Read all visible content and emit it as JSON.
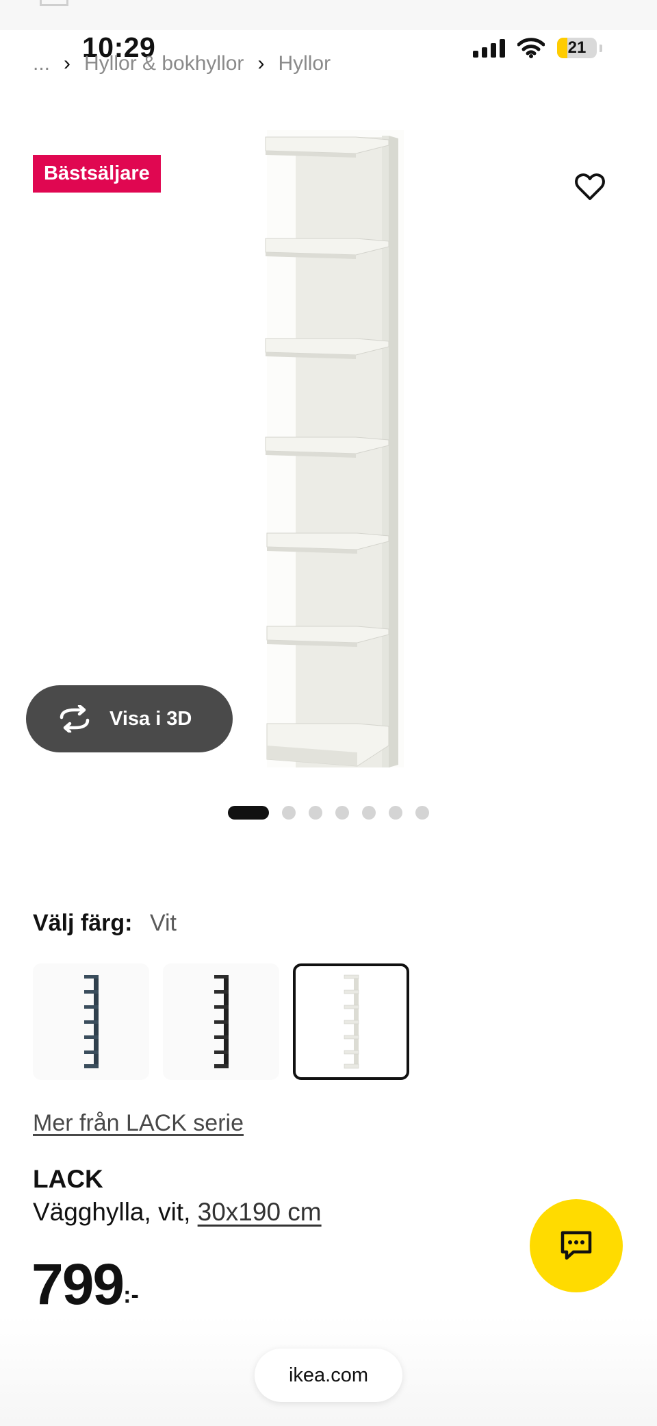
{
  "status_bar": {
    "time": "10:29",
    "battery_level": "21",
    "icons": [
      "signal-icon",
      "wifi-icon",
      "battery-icon"
    ]
  },
  "breadcrumb": {
    "items": [
      "...",
      "Hyllor & bokhyllor",
      "Hyllor"
    ]
  },
  "badge": {
    "label": "Bästsäljare",
    "color": "#e00751"
  },
  "favorite": {
    "icon": "heart-icon"
  },
  "view_3d": {
    "label": "Visa i 3D",
    "icon": "rotate-icon"
  },
  "carousel": {
    "total": 7,
    "active_index": 0
  },
  "color_select": {
    "label": "Välj färg:",
    "selected": "Vit",
    "options": [
      "Blågrå",
      "Svartbrun",
      "Vit"
    ]
  },
  "series_link": "Mer från LACK serie",
  "product": {
    "name": "LACK",
    "description": "Vägghylla, vit, ",
    "size": "30x190 cm"
  },
  "price": {
    "amount": "799",
    "suffix": ":-"
  },
  "chat": {
    "icon": "chat-icon",
    "color": "#ffdb00"
  },
  "browser": {
    "url": "ikea.com"
  }
}
